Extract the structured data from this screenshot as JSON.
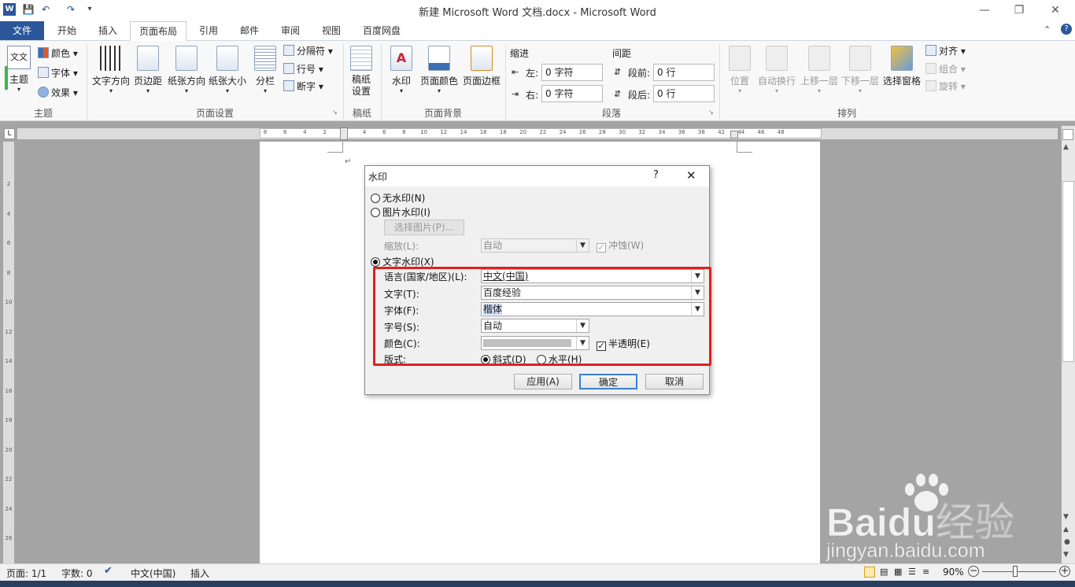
{
  "titlebar": {
    "title": "新建 Microsoft Word 文档.docx - Microsoft Word"
  },
  "tabs": {
    "file": "文件",
    "items": [
      "开始",
      "插入",
      "页面布局",
      "引用",
      "邮件",
      "审阅",
      "视图",
      "百度网盘"
    ],
    "active": "页面布局"
  },
  "ribbon": {
    "theme": {
      "theme": "主题",
      "colors": "颜色",
      "fonts": "字体",
      "effects": "效果",
      "label": "主题"
    },
    "page_setup": {
      "text_dir": "文字方向",
      "margins": "页边距",
      "orientation": "纸张方向",
      "size": "纸张大小",
      "columns": "分栏",
      "breaks": "分隔符",
      "line_numbers": "行号",
      "hyphenation": "断字",
      "label": "页面设置"
    },
    "manuscript": {
      "btn": "稿纸\n设置",
      "label": "稿纸"
    },
    "page_bg": {
      "watermark": "水印",
      "page_color": "页面颜色",
      "page_borders": "页面边框",
      "label": "页面背景"
    },
    "paragraph": {
      "indent": "缩进",
      "spacing": "间距",
      "left": "左:",
      "right": "右:",
      "before": "段前:",
      "after": "段后:",
      "left_val": "0 字符",
      "right_val": "0 字符",
      "before_val": "0 行",
      "after_val": "0 行",
      "label": "段落"
    },
    "arrange": {
      "position": "位置",
      "wrap": "自动换行",
      "forward": "上移一层",
      "backward": "下移一层",
      "selection": "选择窗格",
      "align": "对齐",
      "group": "组合",
      "rotate": "旋转",
      "label": "排列"
    }
  },
  "ruler": {
    "h": [
      "8",
      "6",
      "4",
      "2",
      "2",
      "4",
      "6",
      "8",
      "10",
      "12",
      "14",
      "16",
      "18",
      "20",
      "22",
      "24",
      "26",
      "28",
      "30",
      "32",
      "34",
      "36",
      "38",
      "42",
      "44",
      "46",
      "48"
    ],
    "v": [
      "2",
      "4",
      "6",
      "8",
      "10",
      "12",
      "14",
      "16",
      "18",
      "20",
      "22",
      "24",
      "26"
    ]
  },
  "dialog": {
    "title": "水印",
    "help": "?",
    "no_wm": "无水印(N)",
    "pic_wm": "图片水印(I)",
    "select_pic": "选择图片(P)...",
    "scale_label": "缩放(L):",
    "scale_val": "自动",
    "washout": "冲蚀(W)",
    "text_wm": "文字水印(X)",
    "lang_label": "语言(国家/地区)(L):",
    "lang_val": "中文(中国)",
    "text_label": "文字(T):",
    "text_val": "百度经验",
    "font_label": "字体(F):",
    "font_val": "楷体",
    "size_label": "字号(S):",
    "size_val": "自动",
    "color_label": "颜色(C):",
    "semi": "半透明(E)",
    "layout_label": "版式:",
    "diagonal": "斜式(D)",
    "horizontal": "水平(H)",
    "apply": "应用(A)",
    "ok": "确定",
    "cancel": "取消"
  },
  "status": {
    "page": "页面: 1/1",
    "words": "字数: 0",
    "lang": "中文(中国)",
    "mode": "插入",
    "zoom": "90%"
  },
  "watermark": {
    "brand": "Baidu经验",
    "url": "jingyan.baidu.com"
  }
}
